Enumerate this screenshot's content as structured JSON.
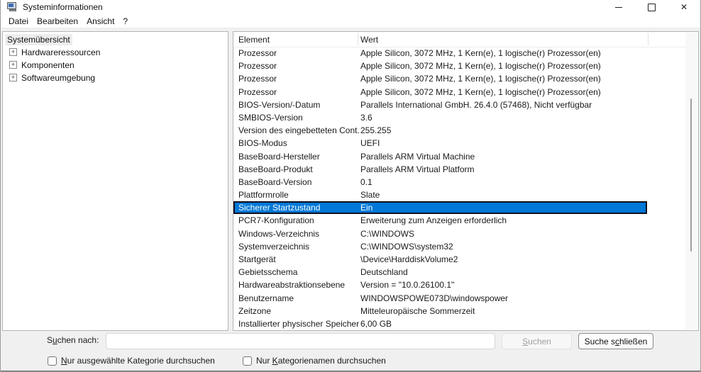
{
  "window": {
    "title": "Systeminformationen",
    "icon": "system-info-icon",
    "controls": {
      "close_glyph": "✕"
    }
  },
  "menubar": {
    "items": [
      {
        "label": "Datei"
      },
      {
        "label": "Bearbeiten"
      },
      {
        "label": "Ansicht"
      },
      {
        "label": "?"
      }
    ]
  },
  "tree": {
    "root_label": "Systemübersicht",
    "items": [
      {
        "label": "Hardwareressourcen"
      },
      {
        "label": "Komponenten"
      },
      {
        "label": "Softwareumgebung"
      }
    ]
  },
  "list": {
    "columns": [
      "Element",
      "Wert"
    ],
    "rows": [
      {
        "element": "Prozessor",
        "wert": "Apple Silicon, 3072 MHz, 1 Kern(e), 1 logische(r) Prozessor(en)"
      },
      {
        "element": "Prozessor",
        "wert": "Apple Silicon, 3072 MHz, 1 Kern(e), 1 logische(r) Prozessor(en)"
      },
      {
        "element": "Prozessor",
        "wert": "Apple Silicon, 3072 MHz, 1 Kern(e), 1 logische(r) Prozessor(en)"
      },
      {
        "element": "Prozessor",
        "wert": "Apple Silicon, 3072 MHz, 1 Kern(e), 1 logische(r) Prozessor(en)"
      },
      {
        "element": "BIOS-Version/-Datum",
        "wert": "Parallels International GmbH. 26.4.0 (57468), Nicht verfügbar"
      },
      {
        "element": "SMBIOS-Version",
        "wert": "3.6"
      },
      {
        "element": "Version des eingebetteten Cont...",
        "wert": "255.255"
      },
      {
        "element": "BIOS-Modus",
        "wert": "UEFI"
      },
      {
        "element": "BaseBoard-Hersteller",
        "wert": "Parallels ARM Virtual Machine"
      },
      {
        "element": "BaseBoard-Produkt",
        "wert": "Parallels ARM Virtual Platform"
      },
      {
        "element": "BaseBoard-Version",
        "wert": "0.1"
      },
      {
        "element": "Plattformrolle",
        "wert": "Slate"
      },
      {
        "element": "Sicherer Startzustand",
        "wert": "Ein",
        "selected": true
      },
      {
        "element": "PCR7-Konfiguration",
        "wert": "Erweiterung zum Anzeigen erforderlich"
      },
      {
        "element": "Windows-Verzeichnis",
        "wert": "C:\\WINDOWS"
      },
      {
        "element": "Systemverzeichnis",
        "wert": "C:\\WINDOWS\\system32"
      },
      {
        "element": "Startgerät",
        "wert": "\\Device\\HarddiskVolume2"
      },
      {
        "element": "Gebietsschema",
        "wert": "Deutschland"
      },
      {
        "element": "Hardwareabstraktionsebene",
        "wert": "Version = \"10.0.26100.1\""
      },
      {
        "element": "Benutzername",
        "wert": "WINDOWSPOWE073D\\windowspower"
      },
      {
        "element": "Zeitzone",
        "wert": "Mitteleuropäische Sommerzeit"
      },
      {
        "element": "Installierter physischer Speicher...",
        "wert": "6,00 GB"
      }
    ]
  },
  "search": {
    "label": {
      "pre": "S",
      "underline": "u",
      "post": "chen nach:"
    },
    "input_value": "",
    "buttons": {
      "search": {
        "pre": "",
        "underline": "S",
        "post": "uchen",
        "disabled": true
      },
      "close": {
        "pre": "Suche s",
        "underline": "c",
        "post": "hließen",
        "disabled": false
      }
    },
    "checkboxes": [
      {
        "pre": "",
        "underline": "N",
        "post": "ur ausgewählte Kategorie durchsuchen",
        "checked": false
      },
      {
        "pre": "Nur ",
        "underline": "K",
        "post": "ategorienamen durchsuchen",
        "checked": false
      }
    ]
  },
  "colors": {
    "selection_bg": "#0078d7",
    "selection_text": "#ffffff",
    "selection_border": "#10101e",
    "titlebar_bg": "#ffffff",
    "body_bg": "#f0f0f0"
  }
}
